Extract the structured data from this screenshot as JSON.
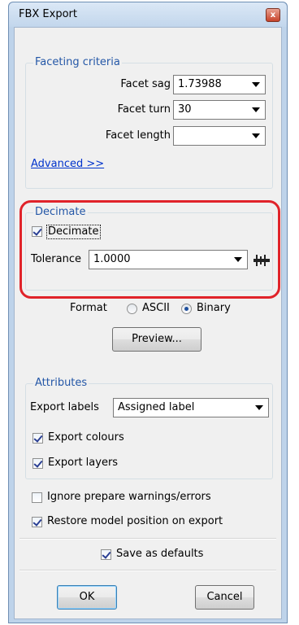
{
  "window": {
    "title": "FBX Export",
    "close_glyph": "x"
  },
  "faceting": {
    "title": "Faceting criteria",
    "facet_sag_label": "Facet sag",
    "facet_sag_value": "1.73988",
    "facet_turn_label": "Facet turn",
    "facet_turn_value": "30",
    "facet_length_label": "Facet length",
    "facet_length_value": "",
    "advanced_link": "Advanced >>"
  },
  "decimate": {
    "title": "Decimate",
    "checkbox_label": "Decimate",
    "checked": true,
    "tolerance_label": "Tolerance",
    "tolerance_value": "1.0000"
  },
  "format": {
    "label": "Format",
    "options": [
      "ASCII",
      "Binary"
    ],
    "selected": "Binary"
  },
  "preview_button": "Preview...",
  "attributes": {
    "title": "Attributes",
    "export_labels_label": "Export labels",
    "export_labels_value": "Assigned label",
    "export_colours_label": "Export colours",
    "export_colours_checked": true,
    "export_layers_label": "Export layers",
    "export_layers_checked": true
  },
  "options": {
    "ignore_warnings_label": "Ignore prepare warnings/errors",
    "ignore_warnings_checked": false,
    "restore_position_label": "Restore model position on export",
    "restore_position_checked": true,
    "save_defaults_label": "Save as defaults",
    "save_defaults_checked": true
  },
  "buttons": {
    "ok": "OK",
    "cancel": "Cancel"
  },
  "colors": {
    "highlight": "#e0232a",
    "group_title": "#2457a7",
    "link": "#0033cc"
  },
  "icons": {
    "tolerance_measure": "ruler-caliper-icon"
  }
}
